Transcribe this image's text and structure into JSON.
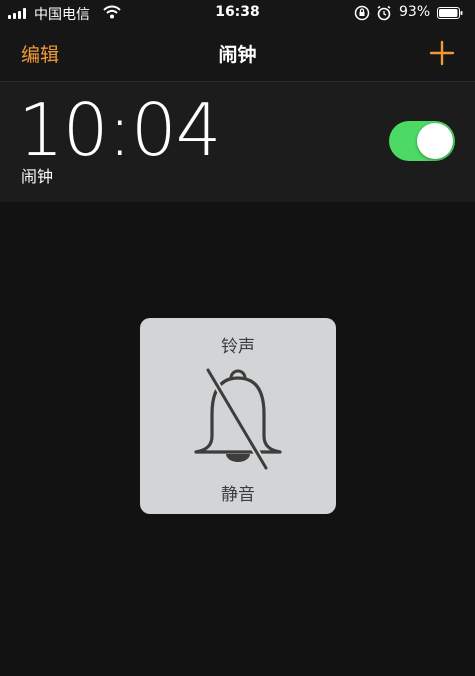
{
  "status_bar": {
    "carrier": "中国电信",
    "time": "16:38",
    "battery_percent": "93%",
    "icons": [
      "signal-icon",
      "wifi-icon",
      "orientation-lock-icon",
      "alarm-clock-icon",
      "battery-icon"
    ]
  },
  "nav": {
    "edit_label": "编辑",
    "title": "闹钟",
    "add_icon": "plus-icon"
  },
  "alarm": {
    "time": "10:04",
    "label": "闹钟",
    "enabled": true
  },
  "ringer_hud": {
    "title": "铃声",
    "status": "静音",
    "icon": "bell-slash-icon"
  },
  "colors": {
    "accent": "#f09a37",
    "toggle_on": "#4cd964",
    "background": "#121212",
    "hud_background": "#d2d4d6"
  }
}
